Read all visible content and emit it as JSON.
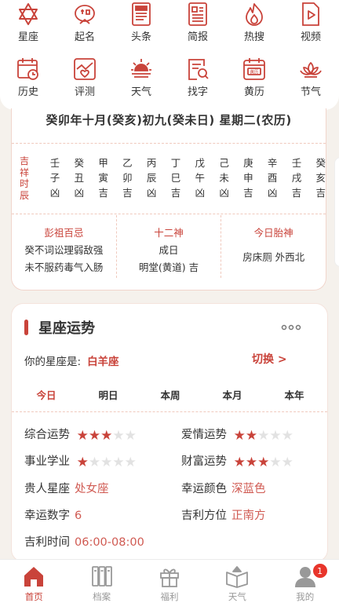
{
  "grid": {
    "row1": [
      {
        "icon": "star-of-david-icon",
        "label": "星座"
      },
      {
        "icon": "name-seal-icon",
        "label": "起名"
      },
      {
        "icon": "newspaper-icon",
        "label": "头条"
      },
      {
        "icon": "brief-report-icon",
        "label": "简报"
      },
      {
        "icon": "flame-icon",
        "label": "热搜"
      },
      {
        "icon": "video-play-icon",
        "label": "视频"
      }
    ],
    "row2": [
      {
        "icon": "history-calendar-icon",
        "label": "历史"
      },
      {
        "icon": "heart-chart-icon",
        "label": "评测"
      },
      {
        "icon": "weather-sun-icon",
        "label": "天气"
      },
      {
        "icon": "search-doc-icon",
        "label": "找字"
      },
      {
        "icon": "almanac-calendar-icon",
        "label": "黄历",
        "icon_text": "黄历"
      },
      {
        "icon": "lotus-icon",
        "label": "节气"
      }
    ]
  },
  "almanac": {
    "lunar_date": "癸卯年十月(癸亥)初九(癸未日) 星期二(农历)",
    "hours_label": [
      "吉",
      "祥",
      "时",
      "辰"
    ],
    "hours": [
      {
        "stem": "壬",
        "branch": "子",
        "luck": "凶"
      },
      {
        "stem": "癸",
        "branch": "丑",
        "luck": "凶"
      },
      {
        "stem": "甲",
        "branch": "寅",
        "luck": "吉"
      },
      {
        "stem": "乙",
        "branch": "卯",
        "luck": "吉"
      },
      {
        "stem": "丙",
        "branch": "辰",
        "luck": "凶"
      },
      {
        "stem": "丁",
        "branch": "巳",
        "luck": "吉"
      },
      {
        "stem": "戊",
        "branch": "午",
        "luck": "凶"
      },
      {
        "stem": "己",
        "branch": "未",
        "luck": "凶"
      },
      {
        "stem": "庚",
        "branch": "申",
        "luck": "吉"
      },
      {
        "stem": "辛",
        "branch": "酉",
        "luck": "凶"
      },
      {
        "stem": "壬",
        "branch": "戌",
        "luck": "吉"
      },
      {
        "stem": "癸",
        "branch": "亥",
        "luck": "吉"
      }
    ],
    "info": [
      {
        "title": "彭祖百忌",
        "lines": [
          "癸不词讼理弱敌强",
          "未不服药毒气入肠"
        ]
      },
      {
        "title": "十二神",
        "lines": [
          "成日",
          "明堂(黄道) 吉"
        ]
      },
      {
        "title": "今日胎神",
        "lines": [
          "房床厕 外西北"
        ]
      }
    ]
  },
  "horoscope": {
    "title": "星座运势",
    "more": "°°°",
    "my_sign_label": "你的星座是:",
    "my_sign": "白羊座",
    "switch_label": "切换 >",
    "tabs": [
      "今日",
      "明日",
      "本周",
      "本月",
      "本年"
    ],
    "active_tab": 0,
    "fortunes": [
      {
        "label": "综合运势",
        "stars": 3,
        "max": 5
      },
      {
        "label": "爱情运势",
        "stars": 2,
        "max": 5
      },
      {
        "label": "事业学业",
        "stars": 1,
        "max": 5
      },
      {
        "label": "财富运势",
        "stars": 3,
        "max": 5
      }
    ],
    "facts": [
      {
        "label": "贵人星座",
        "value": "处女座"
      },
      {
        "label": "幸运颜色",
        "value": "深蓝色"
      },
      {
        "label": "幸运数字",
        "value": "6"
      },
      {
        "label": "吉利方位",
        "value": "正南方"
      },
      {
        "label": "吉利时间",
        "value": "06:00-08:00"
      }
    ]
  },
  "nav": [
    {
      "icon": "home-icon",
      "label": "首页",
      "active": true
    },
    {
      "icon": "archive-icon",
      "label": "档案"
    },
    {
      "icon": "gift-icon",
      "label": "福利"
    },
    {
      "icon": "weather-book-icon",
      "label": "天气"
    },
    {
      "icon": "profile-icon",
      "label": "我的",
      "badge": "1"
    }
  ],
  "colors": {
    "accent": "#c9433a",
    "text": "#333333",
    "muted": "#999999",
    "badge": "#e8352b"
  }
}
